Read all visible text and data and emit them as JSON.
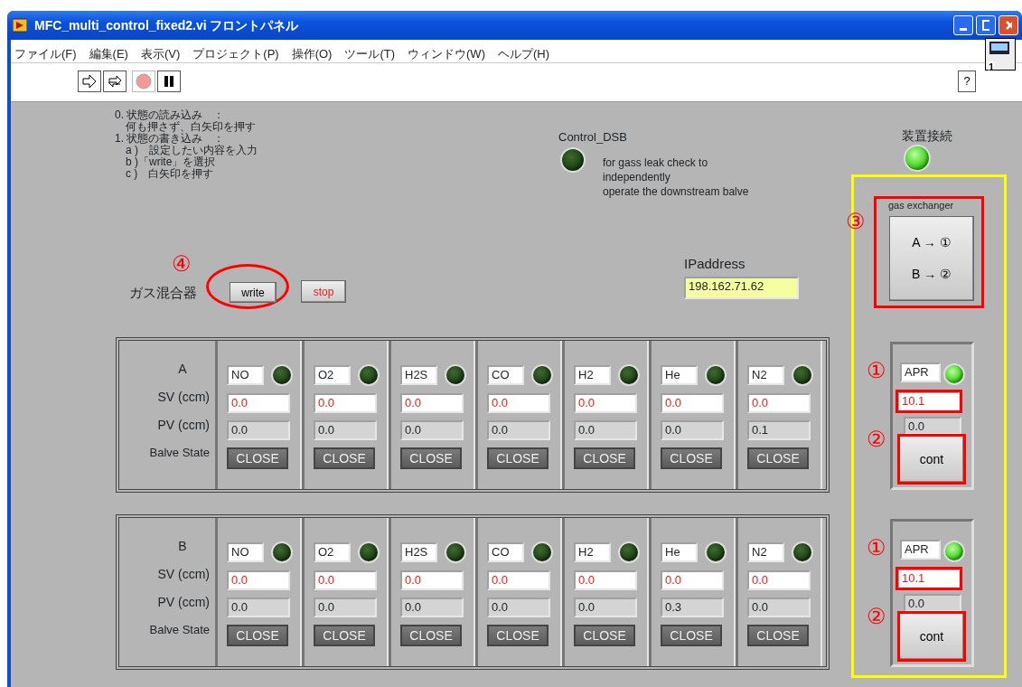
{
  "window": {
    "title": "MFC_multi_control_fixed2.vi フロントパネル"
  },
  "menu": [
    "ファイル(F)",
    "編集(E)",
    "表示(V)",
    "プロジェクト(P)",
    "操作(O)",
    "ツール(T)",
    "ウィンドウ(W)",
    "ヘルプ(H)"
  ],
  "toolbar": {
    "help": "?",
    "vi_icon_label": "1"
  },
  "instructions": [
    "0. 状態の読み込み　：",
    "　何も押さず、白矢印を押す",
    "1. 状態の書き込み　：",
    "　a )　設定したい内容を入力",
    "　b )「write」を選択",
    "　c )　白矢印を押す"
  ],
  "control_dsb": {
    "label": "Control_DSB",
    "on": false,
    "note": [
      "for gass leak check to",
      "independently",
      "operate the downstream balve"
    ]
  },
  "device_connection": {
    "label": "装置接続",
    "on": true
  },
  "gas_mixer": {
    "label": "ガス混合器",
    "mark": "④",
    "circled": true,
    "write": "write",
    "stop": "stop"
  },
  "ip": {
    "label": "IPaddress",
    "value": "198.162.71.62"
  },
  "groups": [
    {
      "label": "A",
      "row_labels": [
        "SV (ccm)",
        "PV (ccm)",
        "Balve State"
      ],
      "channels": [
        {
          "gas": "NO",
          "on": false,
          "sv": "0.0",
          "pv": "0.0",
          "valve": "CLOSE"
        },
        {
          "gas": "O2",
          "on": false,
          "sv": "0.0",
          "pv": "0.0",
          "valve": "CLOSE"
        },
        {
          "gas": "H2S",
          "on": false,
          "sv": "0.0",
          "pv": "0.0",
          "valve": "CLOSE"
        },
        {
          "gas": "CO",
          "on": false,
          "sv": "0.0",
          "pv": "0.0",
          "valve": "CLOSE"
        },
        {
          "gas": "H2",
          "on": false,
          "sv": "0.0",
          "pv": "0.0",
          "valve": "CLOSE"
        },
        {
          "gas": "He",
          "on": false,
          "sv": "0.0",
          "pv": "0.0",
          "valve": "CLOSE"
        },
        {
          "gas": "N2",
          "on": false,
          "sv": "0.0",
          "pv": "0.1",
          "valve": "CLOSE"
        }
      ]
    },
    {
      "label": "B",
      "row_labels": [
        "SV (ccm)",
        "PV (ccm)",
        "Balve State"
      ],
      "channels": [
        {
          "gas": "NO",
          "on": false,
          "sv": "0.0",
          "pv": "0.0",
          "valve": "CLOSE"
        },
        {
          "gas": "O2",
          "on": false,
          "sv": "0.0",
          "pv": "0.0",
          "valve": "CLOSE"
        },
        {
          "gas": "H2S",
          "on": false,
          "sv": "0.0",
          "pv": "0.0",
          "valve": "CLOSE"
        },
        {
          "gas": "CO",
          "on": false,
          "sv": "0.0",
          "pv": "0.0",
          "valve": "CLOSE"
        },
        {
          "gas": "H2",
          "on": false,
          "sv": "0.0",
          "pv": "0.0",
          "valve": "CLOSE"
        },
        {
          "gas": "He",
          "on": false,
          "sv": "0.0",
          "pv": "0.3",
          "valve": "CLOSE"
        },
        {
          "gas": "N2",
          "on": false,
          "sv": "0.0",
          "pv": "0.0",
          "valve": "CLOSE"
        }
      ]
    }
  ],
  "gas_exchanger": {
    "label": "gas exchanger",
    "mark": "③",
    "highlighted": true,
    "lines": [
      "A → ①",
      "B → ②"
    ]
  },
  "apr_units": [
    {
      "gas": "APR",
      "on": true,
      "sv": "10.1",
      "pv": "0.0",
      "button": "cont",
      "sv_mark": "①",
      "button_mark": "②",
      "highlighted": true
    },
    {
      "gas": "APR",
      "on": true,
      "sv": "10.1",
      "pv": "0.0",
      "button": "cont",
      "sv_mark": "①",
      "button_mark": "②",
      "highlighted": true
    }
  ]
}
